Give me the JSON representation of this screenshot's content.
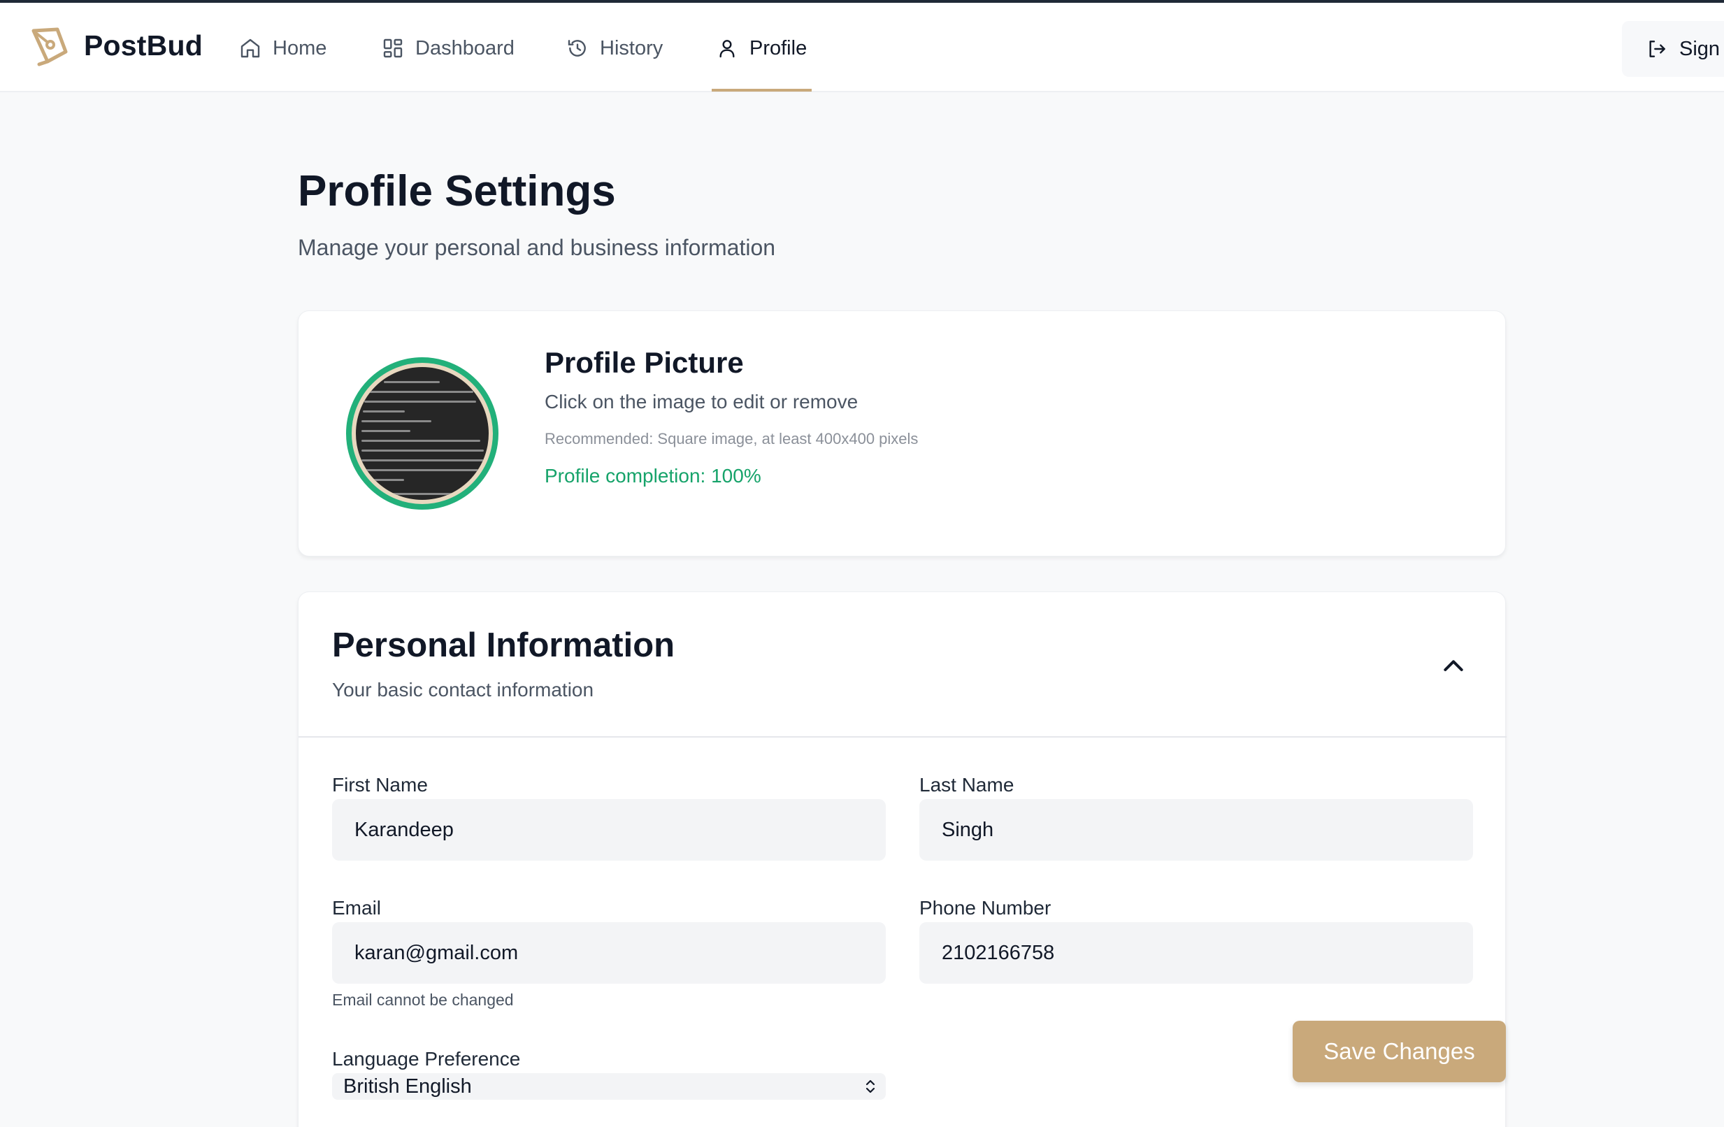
{
  "app": {
    "name": "PostBud"
  },
  "nav": {
    "items": [
      {
        "label": "Home",
        "icon": "home-icon"
      },
      {
        "label": "Dashboard",
        "icon": "dashboard-icon"
      },
      {
        "label": "History",
        "icon": "history-icon"
      },
      {
        "label": "Profile",
        "icon": "user-icon",
        "active": true
      }
    ],
    "signout_label": "Sign"
  },
  "page": {
    "title": "Profile Settings",
    "subtitle": "Manage your personal and business information"
  },
  "profile_picture": {
    "title": "Profile Picture",
    "subtitle": "Click on the image to edit or remove",
    "recommendation": "Recommended: Square image, at least 400x400 pixels",
    "completion": "Profile completion: 100%"
  },
  "personal_info": {
    "title": "Personal Information",
    "subtitle": "Your basic contact information",
    "first_name": {
      "label": "First Name",
      "value": "Karandeep"
    },
    "last_name": {
      "label": "Last Name",
      "value": "Singh"
    },
    "email": {
      "label": "Email",
      "value": "karan@gmail.com",
      "hint": "Email cannot be changed"
    },
    "phone": {
      "label": "Phone Number",
      "value": "2102166758"
    },
    "language": {
      "label": "Language Preference",
      "value": "British English"
    }
  },
  "actions": {
    "save_label": "Save Changes"
  },
  "colors": {
    "accent": "#c9a97b",
    "success": "#16a36a",
    "ring": "#22b07a"
  }
}
